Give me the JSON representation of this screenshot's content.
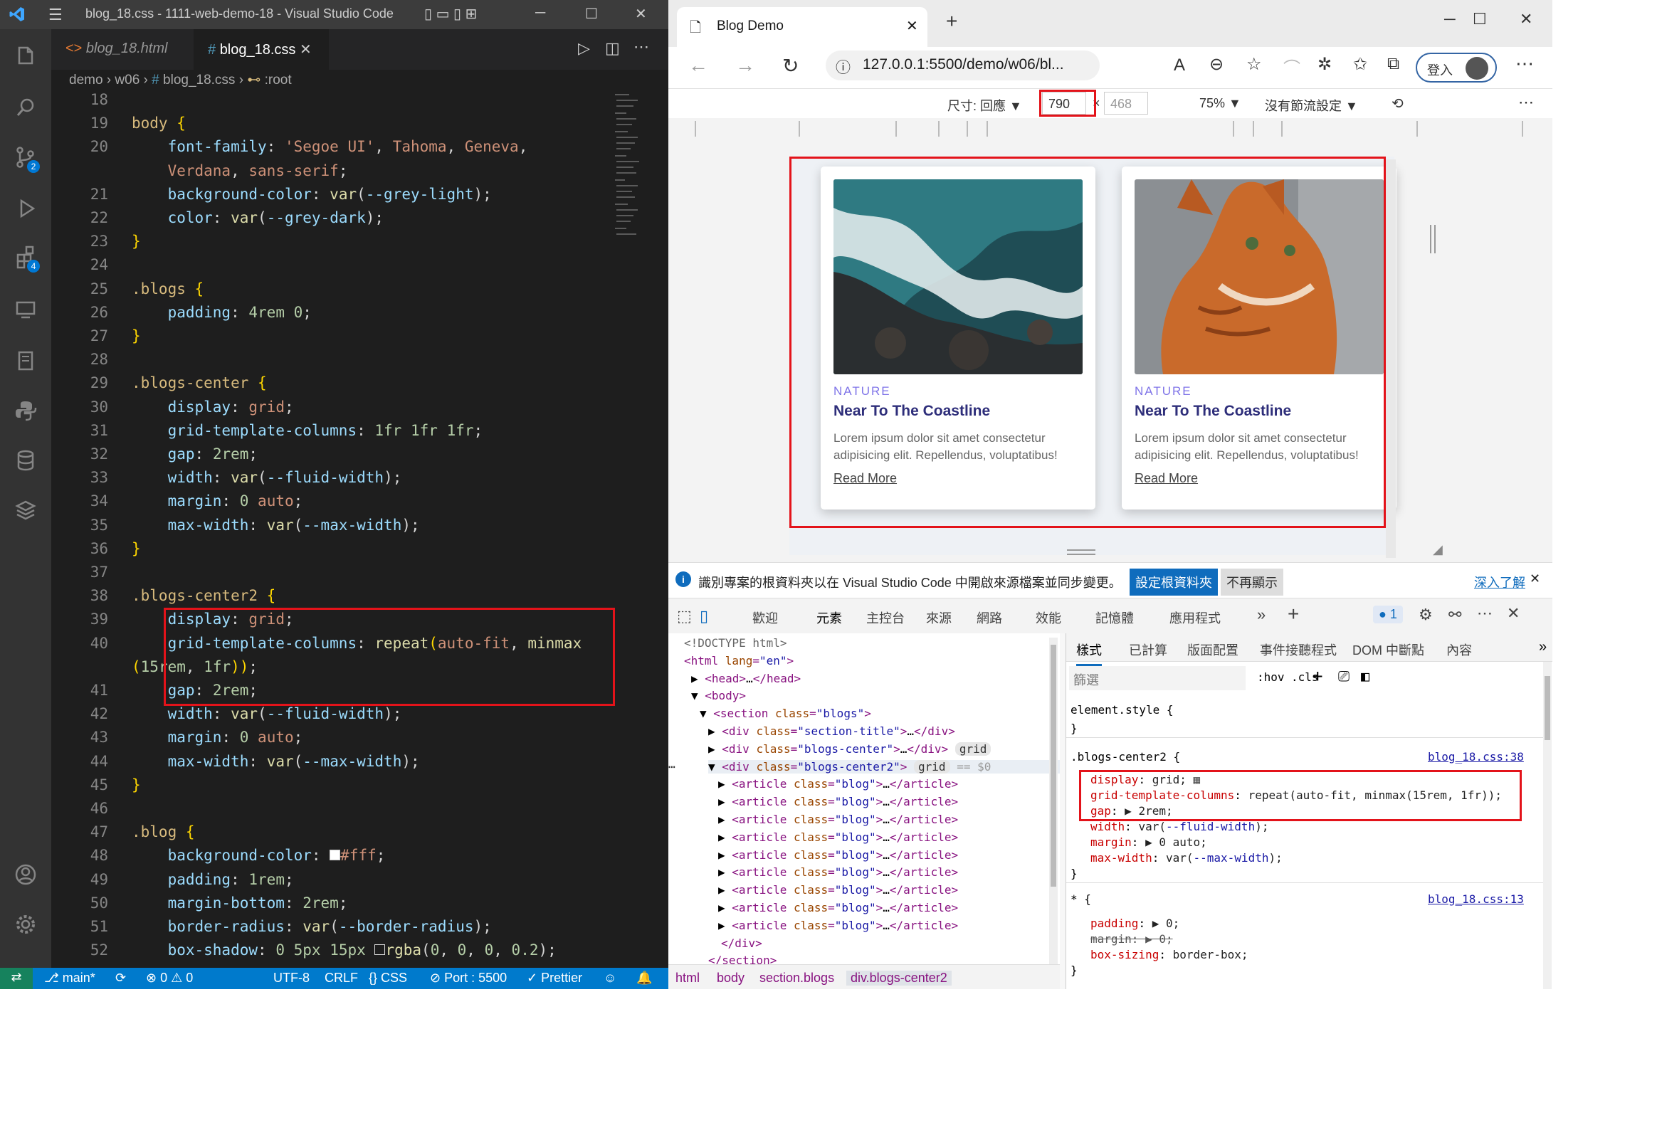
{
  "vscode": {
    "title": "blog_18.css - 1111-web-demo-18 - Visual Studio Code",
    "tabs": [
      {
        "label": "blog_18.html",
        "icon": "html-icon"
      },
      {
        "label": "blog_18.css",
        "icon": "css-hash-icon"
      }
    ],
    "breadcrumb": {
      "p1": "demo",
      "p2": "w06",
      "p3": "blog_18.css",
      "p4": ":root"
    },
    "badges": {
      "scm": "2",
      "extensions": "4"
    },
    "line_numbers": [
      "18",
      "19",
      "20",
      "",
      "21",
      "22",
      "23",
      "24",
      "25",
      "26",
      "27",
      "28",
      "29",
      "30",
      "31",
      "32",
      "33",
      "34",
      "35",
      "36",
      "37",
      "38",
      "39",
      "40",
      "",
      "41",
      "42",
      "43",
      "44",
      "45",
      "46",
      "47",
      "48",
      "49",
      "50",
      "51",
      "52"
    ],
    "status": {
      "branch": "main*",
      "problems": "⊗ 0 ⚠ 0",
      "encoding": "UTF-8",
      "eol": "CRLF",
      "lang": "CSS",
      "port": "Port : 5500",
      "prettier": "✓ Prettier"
    }
  },
  "browser": {
    "tab_title": "Blog Demo",
    "url": "127.0.0.1:5500/demo/w06/bl...",
    "login": "登入",
    "device_label": "尺寸: 回應",
    "width": "790",
    "height": "468",
    "zoom": "75%",
    "throttle": "沒有節流設定",
    "cards": [
      {
        "category": "NATURE",
        "title": "Near To The Coastline",
        "desc": "Lorem ipsum dolor sit amet consectetur adipisicing elit. Repellendus, voluptatibus!",
        "link": "Read More"
      },
      {
        "category": "NATURE",
        "title": "Near To The Coastline",
        "desc": "Lorem ipsum dolor sit amet consectetur adipisicing elit. Repellendus, voluptatibus!",
        "link": "Read More"
      }
    ],
    "infobar": {
      "text": "識別專案的根資料夾以在 Visual Studio Code 中開啟來源檔案並同步變更。",
      "btn1": "設定根資料夾",
      "btn2": "不再顯示",
      "link": "深入了解"
    },
    "devtools_tabs": [
      "歡迎",
      "元素",
      "主控台",
      "來源",
      "網路",
      "效能",
      "記憶體",
      "應用程式"
    ],
    "issues": "1",
    "dom_badges": {
      "grid": "grid",
      "grid2": "grid",
      "eq": "== $0"
    },
    "styles_tabs": [
      "樣式",
      "已計算",
      "版面配置",
      "事件接聽程式",
      "DOM 中斷點",
      "內容"
    ],
    "filter_placeholder": "篩選",
    "hov": ":hov",
    "cls": ".cls",
    "styles": {
      "element_style": "element.style {",
      "close": "}",
      "rule1_selector": ".blogs-center2 {",
      "rule1_src": "blog_18.css:38",
      "rule2_selector": "* {",
      "rule2_src": "blog_18.css:13"
    },
    "crumbs": [
      "html",
      "body",
      "section.blogs",
      "div.blogs-center2"
    ]
  }
}
